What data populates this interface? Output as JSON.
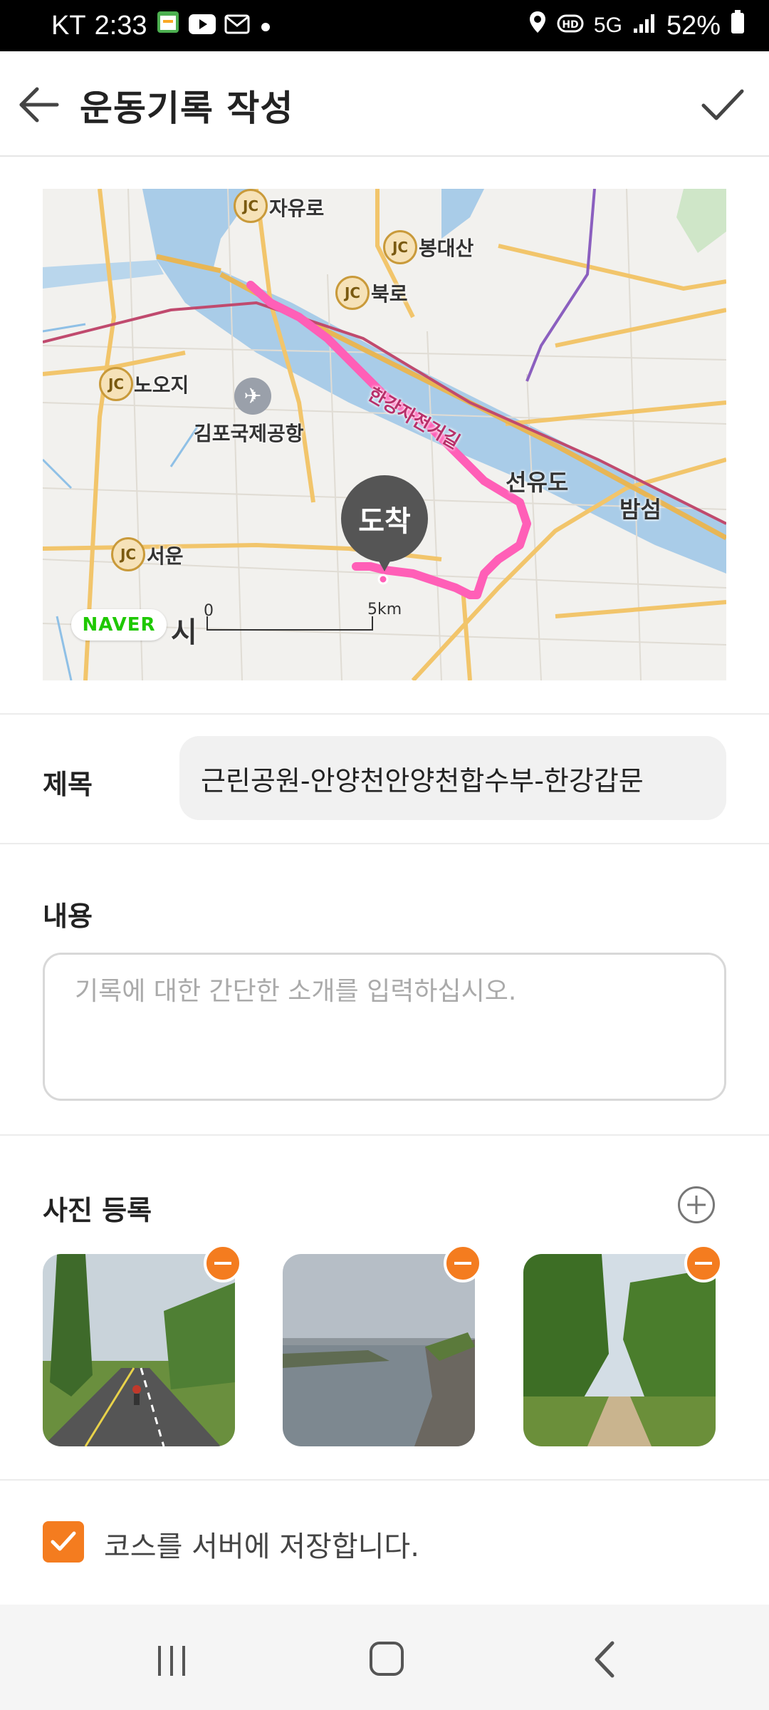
{
  "status_bar": {
    "carrier": "KT",
    "time": "2:33",
    "network": "5G",
    "battery": "52%",
    "icons": [
      "calendar-app-icon",
      "youtube-icon",
      "mail-icon",
      "dot-icon",
      "location-icon",
      "hd-voice-icon",
      "signal-icon",
      "battery-icon"
    ]
  },
  "header": {
    "title": "운동기록 작성",
    "back_icon": "back-arrow-icon",
    "confirm_icon": "check-icon"
  },
  "map": {
    "labels": {
      "jayuro": "자유로",
      "bongdaesan": "봉대산",
      "bukro": "북로",
      "nojoji": "노오지",
      "gimpo_airport": "김포국제공항",
      "seoun": "서운",
      "hangang_bike_road": "한강자전거길",
      "seonyudo": "선유도",
      "bamseom": "밤섬",
      "city_fragment": "시"
    },
    "jc_label": "JC",
    "marker_label": "도착",
    "provider": "NAVER",
    "scale_start": "0",
    "scale_end": "5km",
    "route_color": "#ff5fb7"
  },
  "form": {
    "title_label": "제목",
    "title_value": "근린공원-안양천안양천합수부-한강갑문",
    "content_label": "내용",
    "content_placeholder": "기록에 대한 간단한 소개를 입력하십시오.",
    "photo_label": "사진 등록",
    "photos": [
      {
        "description_icon": "photo-bike-path"
      },
      {
        "description_icon": "photo-river"
      },
      {
        "description_icon": "photo-trail"
      }
    ],
    "save_course_label": "코스를 서버에 저장합니다.",
    "save_course_checked": true
  },
  "colors": {
    "accent": "#f47c1f",
    "naver_green": "#1ec800"
  }
}
